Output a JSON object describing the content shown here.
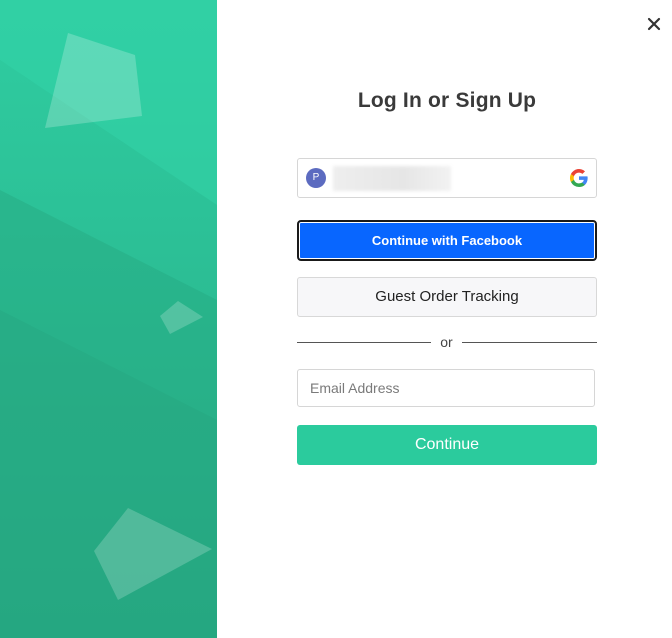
{
  "modal": {
    "title": "Log In or Sign Up",
    "close_icon": "close-icon"
  },
  "google_account": {
    "avatar_initial": "P",
    "provider_icon": "google-icon"
  },
  "facebook": {
    "label": "Continue with Facebook"
  },
  "guest": {
    "label": "Guest Order Tracking"
  },
  "divider": {
    "text": "or"
  },
  "email": {
    "placeholder": "Email Address",
    "value": ""
  },
  "continue": {
    "label": "Continue"
  },
  "colors": {
    "brand_green": "#2bcb9d",
    "facebook_blue": "#0866ff",
    "side_panel_green": "#29b68e"
  }
}
